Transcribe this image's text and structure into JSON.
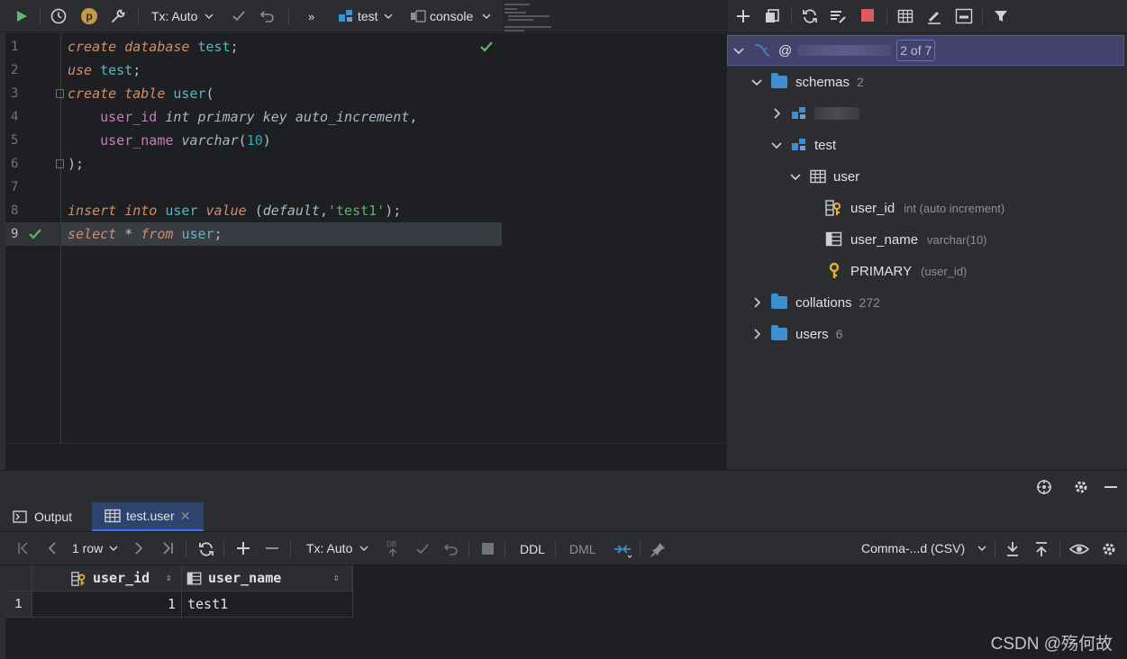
{
  "editor_toolbar": {
    "run_icon": "play-icon",
    "history_icon": "clock-icon",
    "profile_badge": "p",
    "settings_icon": "wrench-icon",
    "tx_mode": "Tx: Auto",
    "commit_icon": "check-icon",
    "rollback_icon": "undo-icon",
    "more": "»",
    "schema": "test",
    "session": "console"
  },
  "editor": {
    "lines": [
      {
        "num": "1",
        "tokens": [
          [
            "kw",
            "create"
          ],
          [
            "plain",
            " "
          ],
          [
            "kw",
            "database"
          ],
          [
            "plain",
            " "
          ],
          [
            "id",
            "test"
          ],
          [
            "plain",
            ";"
          ]
        ]
      },
      {
        "num": "2",
        "tokens": [
          [
            "kw",
            "use"
          ],
          [
            "plain",
            " "
          ],
          [
            "id",
            "test"
          ],
          [
            "plain",
            ";"
          ]
        ]
      },
      {
        "num": "3",
        "tokens": [
          [
            "kw",
            "create"
          ],
          [
            "plain",
            " "
          ],
          [
            "kw",
            "table"
          ],
          [
            "plain",
            " "
          ],
          [
            "id",
            "user"
          ],
          [
            "plain",
            "("
          ]
        ]
      },
      {
        "num": "4",
        "tokens": [
          [
            "plain",
            "    "
          ],
          [
            "col",
            "user_id"
          ],
          [
            "plain",
            " "
          ],
          [
            "kw2",
            "int primary key auto_increment"
          ],
          [
            "plain",
            ","
          ]
        ]
      },
      {
        "num": "5",
        "tokens": [
          [
            "plain",
            "    "
          ],
          [
            "col",
            "user_name"
          ],
          [
            "plain",
            " "
          ],
          [
            "kw2",
            "varchar"
          ],
          [
            "plain",
            "("
          ],
          [
            "num",
            "10"
          ],
          [
            "plain",
            ")"
          ]
        ]
      },
      {
        "num": "6",
        "tokens": [
          [
            "plain",
            ");"
          ]
        ]
      },
      {
        "num": "7",
        "tokens": []
      },
      {
        "num": "8",
        "tokens": [
          [
            "kw",
            "insert"
          ],
          [
            "plain",
            " "
          ],
          [
            "kw",
            "into"
          ],
          [
            "plain",
            " "
          ],
          [
            "id",
            "user"
          ],
          [
            "plain",
            " "
          ],
          [
            "kw",
            "value"
          ],
          [
            "plain",
            " ("
          ],
          [
            "kw2",
            "default"
          ],
          [
            "plain",
            ","
          ],
          [
            "str",
            "'test1'"
          ],
          [
            "plain",
            ");"
          ]
        ]
      },
      {
        "num": "9",
        "tokens": [
          [
            "kw",
            "select"
          ],
          [
            "plain",
            " * "
          ],
          [
            "kw",
            "from"
          ],
          [
            "plain",
            " "
          ],
          [
            "id",
            "user"
          ],
          [
            "plain",
            ";"
          ]
        ]
      }
    ],
    "current_line": 9
  },
  "db_panel": {
    "connection_label": "@",
    "connection_pager": "2 of 7",
    "schemas": {
      "label": "schemas",
      "count": "2"
    },
    "schema_test": "test",
    "table_user": "user",
    "columns": [
      {
        "name": "user_id",
        "hint": "int (auto increment)",
        "icon": "key-column-icon"
      },
      {
        "name": "user_name",
        "hint": "varchar(10)",
        "icon": "column-icon"
      }
    ],
    "index": {
      "name": "PRIMARY",
      "hint": "(user_id)"
    },
    "collations": {
      "label": "collations",
      "count": "272"
    },
    "users": {
      "label": "users",
      "count": "6"
    }
  },
  "bottom": {
    "tab_output": "Output",
    "tab_result": "test.user",
    "row_count": "1 row",
    "tx_mode": "Tx: Auto",
    "ddl": "DDL",
    "dml": "DML",
    "export_format": "Comma-...d (CSV)",
    "columns": [
      "user_id",
      "user_name"
    ],
    "rows": [
      {
        "num": "1",
        "user_id": "1",
        "user_name": "test1"
      }
    ]
  },
  "watermark": "CSDN @殇何故",
  "colors": {
    "accent": "#3574f0",
    "run_green": "#5fb865",
    "stop_red": "#db5c5c",
    "key_yellow": "#e8b130"
  }
}
